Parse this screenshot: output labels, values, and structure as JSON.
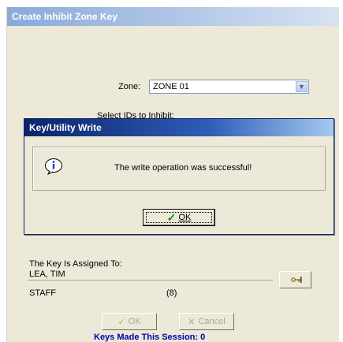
{
  "main_window": {
    "title": "Create Inhibit Zone Key",
    "zone_label": "Zone:",
    "zone_value": "ZONE 01",
    "select_ids_label": "Select IDs to Inhibit:",
    "assigned_label": "The Key Is Assigned To:",
    "assigned_name": "LEA, TIM",
    "staff_label": "STAFF",
    "count_label": "(8)",
    "ok_label": "OK",
    "cancel_label": "Cancel",
    "session_label": "Keys Made This Session: 0"
  },
  "dialog": {
    "title": "Key/Utility Write",
    "message": "The write operation was successful!",
    "ok_label": "OK"
  },
  "icons": {
    "info": "info-icon",
    "check": "check-icon",
    "key": "key-icon",
    "cancel": "cancel-icon",
    "dropdown": "chevron-down-icon"
  },
  "colors": {
    "dialog_title": "#0a246a",
    "session_text": "#0000a8",
    "check": "#1e8a12"
  }
}
